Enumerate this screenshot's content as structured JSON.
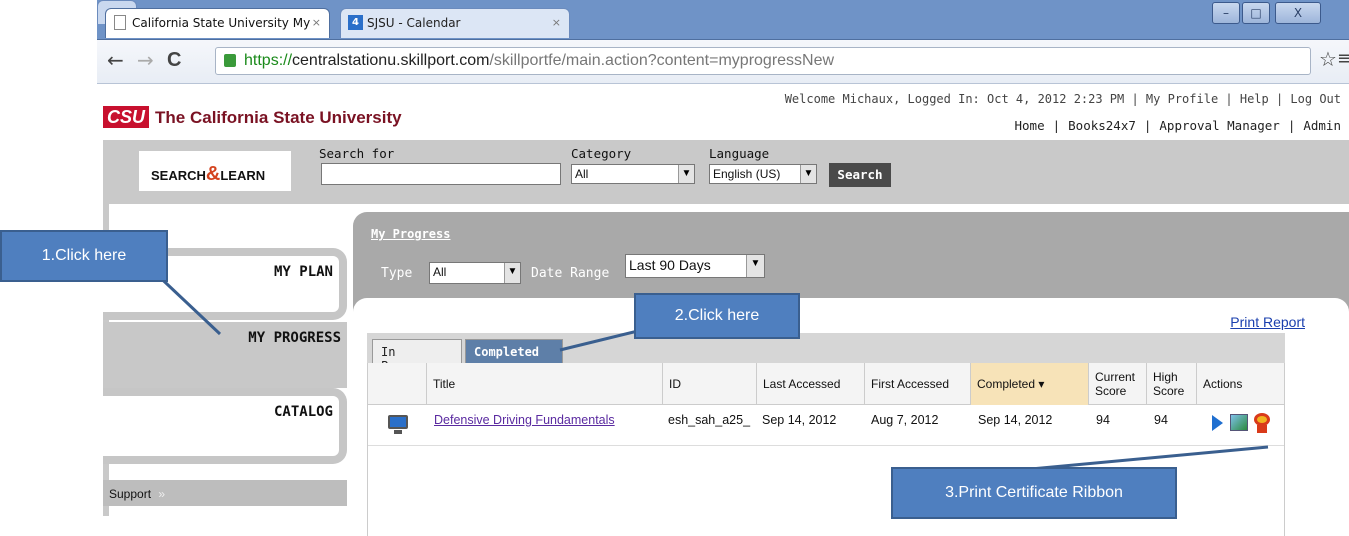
{
  "browser": {
    "tabs": [
      {
        "label": "California State University  My ",
        "close": "×"
      },
      {
        "label": "SJSU - Calendar",
        "close": "×",
        "badge": "4"
      }
    ],
    "url": {
      "scheme": "https://",
      "host": "centralstationu.skillport.com",
      "path": "/skillportfe/main.action?content=myprogressNew"
    },
    "nav": {
      "back": "←",
      "forward": "→",
      "reload": "C",
      "star": "☆",
      "menu": "≡"
    },
    "window_buttons": {
      "minimize": "–",
      "maximize": "□",
      "close": "X"
    }
  },
  "header": {
    "welcome": "Welcome Michaux, Logged In: Oct 4, 2012 2:23 PM | My Profile | Help | Log Out",
    "logo_mark": "CSU",
    "logo_name": "The California State University",
    "topnav": [
      "Home",
      "Books24x7",
      "Approval Manager",
      "Admin"
    ],
    "topnav_sep": "|"
  },
  "search": {
    "brand_left": "SEARCH",
    "brand_amp": "&",
    "brand_right": "LEARN",
    "search_for_label": "Search for",
    "search_value": "",
    "category_label": "Category",
    "category_value": "All",
    "language_label": "Language",
    "language_value": "English (US)",
    "button": "Search"
  },
  "leftnav": {
    "my_plan": "MY PLAN",
    "my_progress": "MY PROGRESS",
    "catalog": "CATALOG",
    "support": "Support",
    "support_chevron": "»"
  },
  "progress": {
    "heading": "My Progress",
    "type_label": "Type",
    "type_value": "All",
    "date_label": "Date Range",
    "date_value": "Last 90 Days",
    "print_report": "Print Report",
    "tabs": [
      "In Progress",
      "Completed"
    ],
    "columns": [
      "Title",
      "ID",
      "Last Accessed",
      "First Accessed",
      "Completed ▾",
      "Current Score",
      "High Score",
      "Actions"
    ],
    "rows": [
      {
        "title": "Defensive Driving Fundamentals",
        "id": "esh_sah_a25_",
        "last": "Sep 14, 2012",
        "first": "Aug 7, 2012",
        "completed": "Sep 14, 2012",
        "current": "94",
        "high": "94"
      }
    ]
  },
  "annotations": {
    "step1": "1.Click here",
    "step2": "2.Click here",
    "step3": "3.Print Certificate Ribbon"
  }
}
